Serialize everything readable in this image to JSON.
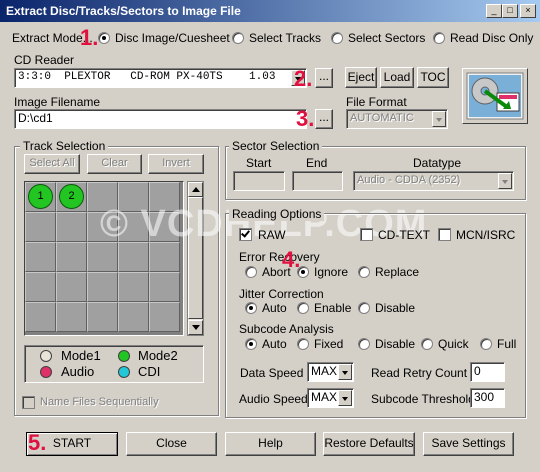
{
  "window": {
    "title": "Extract Disc/Tracks/Sectors to Image File",
    "minimize": "_",
    "maximize": "□",
    "close": "×"
  },
  "mode": {
    "label": "Extract Mode...",
    "options": [
      "Disc Image/Cuesheet",
      "Select Tracks",
      "Select Sectors",
      "Read Disc Only"
    ],
    "selected": "Disc Image/Cuesheet"
  },
  "cd_reader": {
    "label": "CD Reader",
    "value": "3:3:0  PLEXTOR   CD-ROM PX-40TS    1.03",
    "browse": "...",
    "eject": "Eject",
    "load": "Load",
    "toc": "TOC"
  },
  "image_file": {
    "label": "Image Filename",
    "value": "D:\\cd1",
    "browse": "..."
  },
  "file_format": {
    "label": "File Format",
    "value": "AUTOMATIC"
  },
  "track_selection": {
    "title": "Track Selection",
    "select_all": "Select All",
    "clear": "Clear",
    "invert": "Invert",
    "tracks": [
      "1",
      "2"
    ],
    "name_files_sequentially": "Name Files Sequentially"
  },
  "legend": [
    {
      "label": "Mode1",
      "color": "#e8e4d8"
    },
    {
      "label": "Mode2",
      "color": "#22c522"
    },
    {
      "label": "Audio",
      "color": "#e0306a"
    },
    {
      "label": "CDI",
      "color": "#22c8d8"
    }
  ],
  "sector_selection": {
    "title": "Sector Selection",
    "start_label": "Start",
    "end_label": "End",
    "datatype_label": "Datatype",
    "datatype_value": "Audio - CDDA (2352)"
  },
  "reading": {
    "title": "Reading Options",
    "raw": "RAW",
    "cd_text": "CD-TEXT",
    "mcn_isrc": "MCN/ISRC",
    "error_recovery": {
      "label": "Error Recovery",
      "options": [
        "Abort",
        "Ignore",
        "Replace"
      ],
      "selected": "Ignore"
    },
    "jitter_correction": {
      "label": "Jitter Correction",
      "options": [
        "Auto",
        "Enable",
        "Disable"
      ],
      "selected": "Auto"
    },
    "subcode_analysis": {
      "label": "Subcode Analysis",
      "options": [
        "Auto",
        "Fixed",
        "Disable",
        "Quick",
        "Full"
      ],
      "selected": "Auto"
    },
    "data_speed": {
      "label": "Data Speed",
      "value": "MAX"
    },
    "audio_speed": {
      "label": "Audio Speed",
      "value": "MAX"
    },
    "read_retry": {
      "label": "Read Retry Count",
      "value": "0"
    },
    "subcode_threshold": {
      "label": "Subcode Threshold",
      "value": "300"
    }
  },
  "buttons": {
    "start": "START",
    "close": "Close",
    "help": "Help",
    "restore": "Restore Defaults",
    "save": "Save Settings"
  },
  "annotations": {
    "step1": "1.",
    "step2": "2.",
    "step3": "3.",
    "step4": "4.",
    "step5": "5."
  },
  "watermark": "© VCDHELP.COM"
}
